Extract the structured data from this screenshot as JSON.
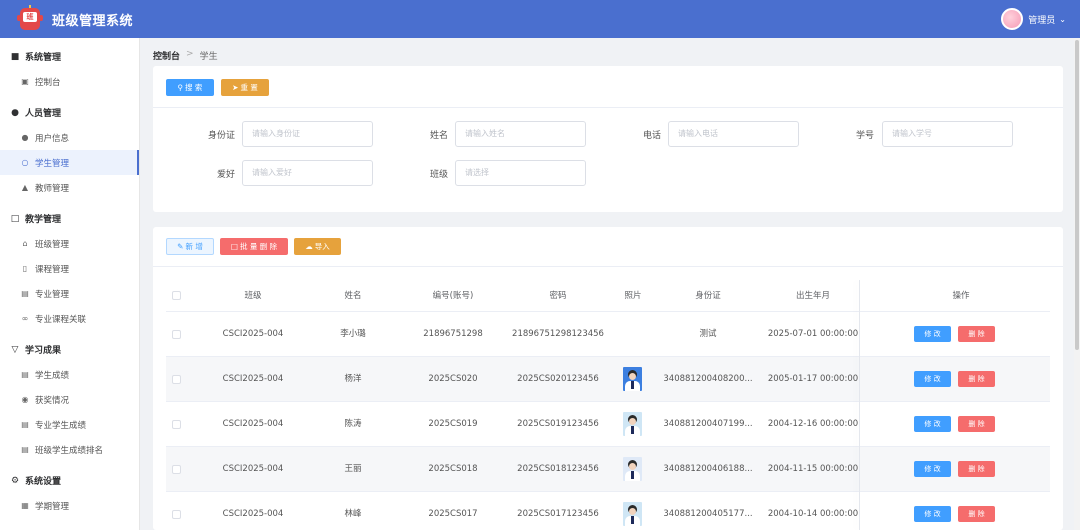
{
  "app": {
    "title": "班级管理系统",
    "user": "管理员",
    "logo_text": "班"
  },
  "sidebar": {
    "groups": [
      {
        "label": "系统管理",
        "icon": "monitor-icon",
        "items": [
          {
            "label": "控制台",
            "icon": "dashboard-icon"
          }
        ]
      },
      {
        "label": "人员管理",
        "icon": "user-icon",
        "items": [
          {
            "label": "用户信息",
            "icon": "user-icon"
          },
          {
            "label": "学生管理",
            "icon": "user-outline-icon",
            "active": true
          },
          {
            "label": "教师管理",
            "icon": "teacher-icon"
          }
        ]
      },
      {
        "label": "教学管理",
        "icon": "book-icon",
        "items": [
          {
            "label": "班级管理",
            "icon": "home-icon"
          },
          {
            "label": "课程管理",
            "icon": "document-icon"
          },
          {
            "label": "专业管理",
            "icon": "notebook-icon"
          },
          {
            "label": "专业课程关联",
            "icon": "link-icon"
          }
        ]
      },
      {
        "label": "学习成果",
        "icon": "trophy-icon",
        "items": [
          {
            "label": "学生成绩",
            "icon": "doc-icon"
          },
          {
            "label": "获奖情况",
            "icon": "medal-icon"
          },
          {
            "label": "专业学生成绩",
            "icon": "doc-icon"
          },
          {
            "label": "班级学生成绩排名",
            "icon": "doc-icon"
          }
        ]
      },
      {
        "label": "系统设置",
        "icon": "gear-icon",
        "items": [
          {
            "label": "学期管理",
            "icon": "calendar-icon"
          }
        ]
      }
    ]
  },
  "breadcrumb": {
    "root": "控制台",
    "current": "学生"
  },
  "search": {
    "search_label": "搜 索",
    "reset_label": "重 置",
    "fields": {
      "idcard": {
        "label": "身份证",
        "placeholder": "请输入身份证"
      },
      "name": {
        "label": "姓名",
        "placeholder": "请输入姓名"
      },
      "phone": {
        "label": "电话",
        "placeholder": "请输入电话"
      },
      "stuno": {
        "label": "学号",
        "placeholder": "请输入学号"
      },
      "hobby": {
        "label": "爱好",
        "placeholder": "请输入爱好"
      },
      "clazz": {
        "label": "班级",
        "placeholder": "请选择"
      }
    }
  },
  "toolbar": {
    "add_label": "新 增",
    "batch_delete_label": "批 量 删 除",
    "import_label": "导入"
  },
  "table": {
    "headers": {
      "clazz": "班级",
      "name": "姓名",
      "no": "编号(账号)",
      "pwd": "密码",
      "photo": "照片",
      "idcard": "身份证",
      "birth": "出生年月",
      "ops": "操作"
    },
    "edit_label": "修 改",
    "delete_label": "删 除",
    "rows": [
      {
        "clazz": "CSCI2025-004",
        "name": "李小璐",
        "no": "21896751298",
        "pwd": "21896751298123456",
        "photo": "",
        "idcard": "测试",
        "birth": "2025-07-01 00:00:00"
      },
      {
        "clazz": "CSCI2025-004",
        "name": "杨洋",
        "no": "2025CS020",
        "pwd": "2025CS020123456",
        "photo": "student-photo",
        "idcard": "340881200408200...",
        "birth": "2005-01-17 00:00:00"
      },
      {
        "clazz": "CSCI2025-004",
        "name": "陈涛",
        "no": "2025CS019",
        "pwd": "2025CS019123456",
        "photo": "student-photo",
        "idcard": "340881200407199...",
        "birth": "2004-12-16 00:00:00"
      },
      {
        "clazz": "CSCI2025-004",
        "name": "王丽",
        "no": "2025CS018",
        "pwd": "2025CS018123456",
        "photo": "student-photo",
        "idcard": "340881200406188...",
        "birth": "2004-11-15 00:00:00"
      },
      {
        "clazz": "CSCI2025-004",
        "name": "林峰",
        "no": "2025CS017",
        "pwd": "2025CS017123456",
        "photo": "student-photo",
        "idcard": "340881200405177...",
        "birth": "2004-10-14 00:00:00"
      }
    ]
  },
  "colors": {
    "header": "#4a6fcf",
    "primary": "#409eff",
    "danger": "#f56c6c",
    "warning": "#e6a23c"
  }
}
